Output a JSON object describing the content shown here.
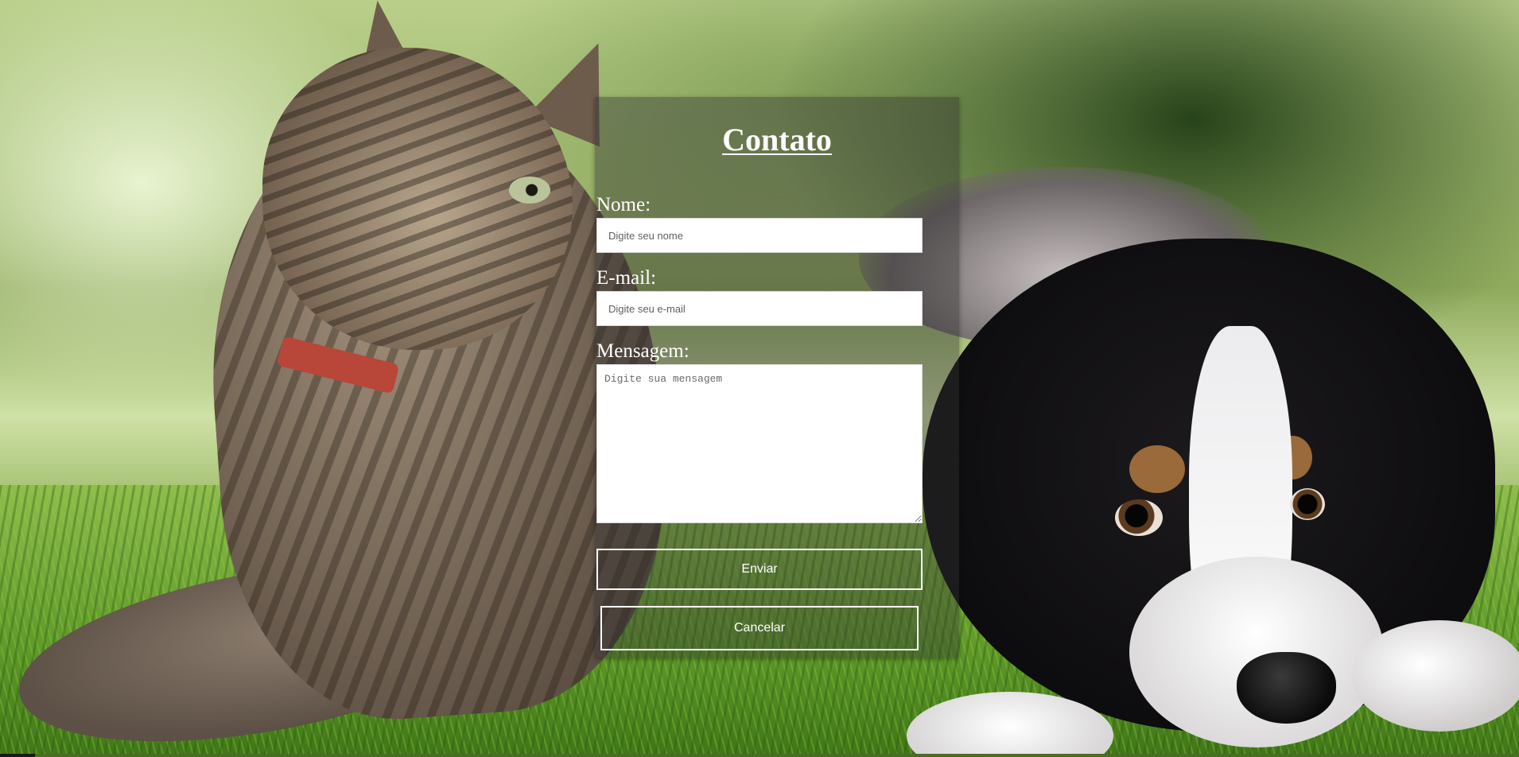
{
  "form": {
    "title": "Contato",
    "name_label": "Nome:",
    "name_placeholder": "Digite seu nome",
    "email_label": "E-mail:",
    "email_placeholder": "Digite seu e-mail",
    "message_label": "Mensagem:",
    "message_placeholder": "Digite sua mensagem",
    "submit_label": "Enviar",
    "cancel_label": "Cancelar"
  },
  "theme": {
    "panel_overlay": "#323232",
    "text_color": "#ffffff",
    "input_background": "#ffffff"
  }
}
